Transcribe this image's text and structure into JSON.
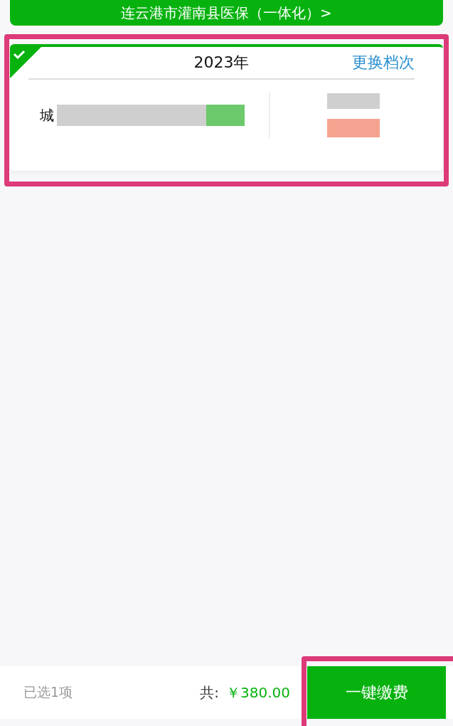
{
  "banner": {
    "label": "连云港市灌南县医保（一体化）>"
  },
  "card": {
    "checked": true,
    "highlighted": true,
    "year": "2023年",
    "change_link": "更换档次",
    "item_label": "城"
  },
  "footer": {
    "selected_count": "已选1项",
    "total_label": "共:",
    "total_amount": "￥380.00",
    "pay_button": "一键缴费",
    "pay_highlighted": true
  }
}
